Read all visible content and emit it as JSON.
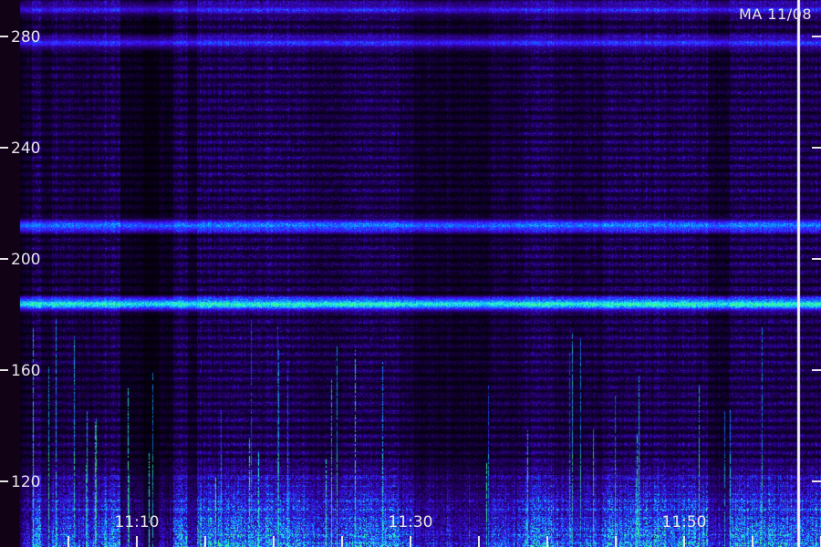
{
  "stamp": "MA 11/08",
  "chart_data": {
    "type": "heatmap",
    "title": "",
    "xlabel": "",
    "ylabel": "",
    "ylim": [
      100,
      295
    ],
    "y_ticks": [
      120,
      160,
      200,
      240,
      280
    ],
    "y_tick_labels": [
      "120",
      "160",
      "200",
      "240",
      "280"
    ],
    "x_range": [
      "11:02",
      "11:62"
    ],
    "x_tick_labels": [
      "11:10",
      "11:30",
      "11:50"
    ],
    "x_minor_ticks_every_min": 5,
    "highlight_time": "11:58",
    "colormap": [
      "#000000",
      "#2a007a",
      "#3c14ff",
      "#0a78ff",
      "#20e8ff",
      "#40ff80"
    ],
    "bands": [
      {
        "freq": 184,
        "intensity": 0.85,
        "label": ""
      },
      {
        "freq": 212,
        "intensity": 0.55,
        "label": ""
      },
      {
        "freq": 278,
        "intensity": 0.35,
        "label": ""
      },
      {
        "freq": 290,
        "intensity": 0.3,
        "label": ""
      }
    ],
    "background_noise_level": 0.3,
    "low_freq_energy_below": 130
  }
}
